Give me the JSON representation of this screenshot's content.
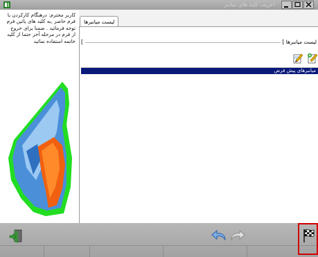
{
  "window": {
    "title": "اعريف كليد هاي ميانبر"
  },
  "info_panel": {
    "text": "کاربر محترم: درهنگام کارکردن با\nفرم حاضر ,به کلید های پائین فرم\nتوجه فرمائید . ضمنا برای خروج\nاز فرم در مرحله آخر حتما از کلید\nخاتمه استفاده نمائید"
  },
  "tabs": [
    {
      "label": "لیست میانبرها"
    }
  ],
  "group": {
    "caption": "لیست میانبرها ]",
    "mark": "["
  },
  "list": {
    "header": "میانبرهای پیش فرض"
  },
  "toolbar_icons": [
    "edit-icon",
    "add-icon"
  ],
  "bottom_icons": [
    "exit-door-icon",
    "undo-arrow-icon",
    "redo-arrow-icon",
    "finish-flag-icon"
  ],
  "colors": {
    "list_header_bg": "#0a1a7a",
    "highlight": "#d00000",
    "art_outline": "#22dd22"
  }
}
